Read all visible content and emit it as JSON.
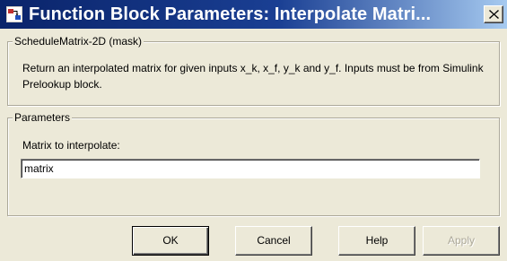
{
  "window": {
    "title": "Function Block Parameters: Interpolate Matri...",
    "close_label": "X"
  },
  "mask_group": {
    "label": "ScheduleMatrix-2D (mask)",
    "description": "Return an interpolated matrix for given inputs x_k, x_f, y_k and y_f. Inputs must be from Simulink Prelookup block."
  },
  "parameters_group": {
    "label": "Parameters",
    "field_label": "Matrix to interpolate:",
    "field_value": "matrix"
  },
  "buttons": {
    "ok": "OK",
    "cancel": "Cancel",
    "help": "Help",
    "apply": "Apply"
  }
}
